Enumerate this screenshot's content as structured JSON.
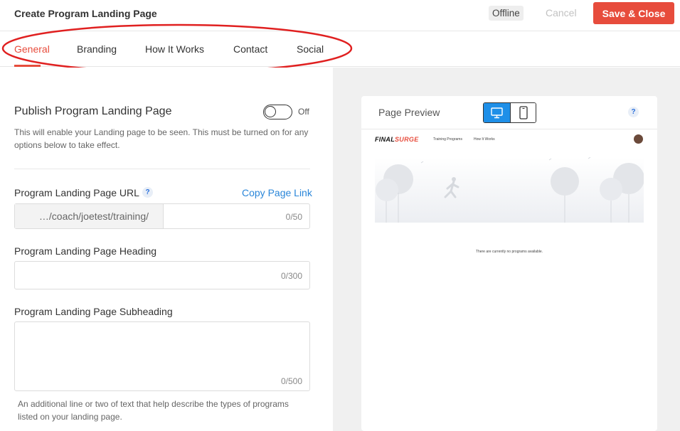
{
  "header": {
    "title": "Create Program Landing Page",
    "status_badge": "Offline",
    "cancel_label": "Cancel",
    "save_label": "Save & Close"
  },
  "tabs": [
    {
      "label": "General",
      "active": true
    },
    {
      "label": "Branding",
      "active": false
    },
    {
      "label": "How It Works",
      "active": false
    },
    {
      "label": "Contact",
      "active": false
    },
    {
      "label": "Social",
      "active": false
    }
  ],
  "publish": {
    "title": "Publish Program Landing Page",
    "toggle_state": "Off",
    "description": "This will enable your Landing page to be seen. This must be turned on for any options below to take effect."
  },
  "url_field": {
    "label": "Program Landing Page URL",
    "help": "?",
    "copy_link": "Copy Page Link",
    "prefix": "…/coach/joetest/training/",
    "value": "",
    "counter": "0/50"
  },
  "heading_field": {
    "label": "Program Landing Page Heading",
    "value": "",
    "counter": "0/300"
  },
  "subheading_field": {
    "label": "Program Landing Page Subheading",
    "value": "",
    "counter": "0/500",
    "description": "An additional line or two of text that help describe the types of programs listed on your landing page."
  },
  "preview": {
    "title": "Page Preview",
    "help": "?",
    "mode": "desktop",
    "mini_page": {
      "logo_part1": "FINAL",
      "logo_part2": "SURGE",
      "nav": [
        "Training Programs",
        "How It Works"
      ],
      "empty_message": "There are currently no programs available."
    }
  },
  "colors": {
    "accent": "#e74c3c",
    "link": "#2a86d9",
    "device_active": "#1e8fe8",
    "annotation": "#e02020"
  }
}
